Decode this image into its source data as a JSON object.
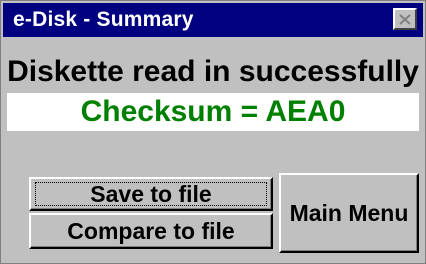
{
  "window": {
    "title": "e-Disk - Summary"
  },
  "icons": {
    "close": "close-icon"
  },
  "body": {
    "message": "Diskette read in successfully",
    "checksum": "Checksum = AEA0"
  },
  "buttons": {
    "save": "Save to file",
    "compare": "Compare to file",
    "main_menu": "Main Menu"
  },
  "colors": {
    "titlebar": "#000080",
    "checksum_text": "#008000",
    "dialog_face": "#c0c0c0"
  }
}
